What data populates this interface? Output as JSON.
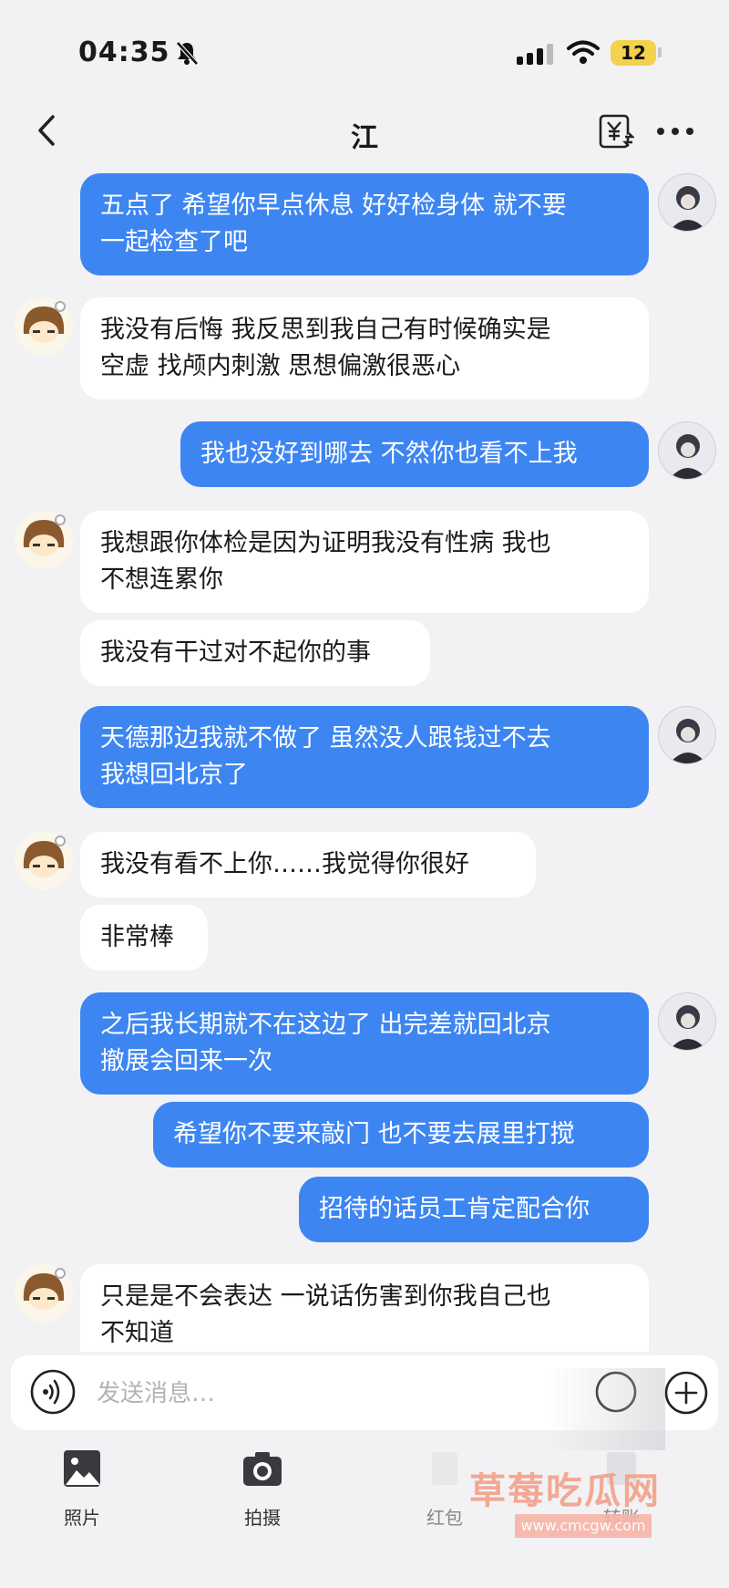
{
  "status_bar": {
    "time": "04:35",
    "battery": "12",
    "icons": [
      "bell-muted-icon",
      "signal-icon",
      "wifi-icon",
      "battery-icon"
    ]
  },
  "header": {
    "title": "江",
    "icons": [
      "back-icon",
      "transfer-yuan-icon",
      "more-icon"
    ]
  },
  "messages": [
    {
      "side": "sent",
      "text": "五点了 希望你早点休息 好好检身体 就不要\n一起检查了吧"
    },
    {
      "side": "recv",
      "text": "我没有后悔 我反思到我自己有时候确实是\n空虚 找颅内刺激 思想偏激很恶心"
    },
    {
      "side": "sent",
      "text": "我也没好到哪去 不然你也看不上我"
    },
    {
      "side": "recv",
      "text": "我想跟你体检是因为证明我没有性病 我也\n不想连累你"
    },
    {
      "side": "recv",
      "text": "我没有干过对不起你的事"
    },
    {
      "side": "sent",
      "text": "天德那边我就不做了 虽然没人跟钱过不去\n我想回北京了"
    },
    {
      "side": "recv",
      "text": "我没有看不上你……我觉得你很好"
    },
    {
      "side": "recv",
      "text": "非常棒"
    },
    {
      "side": "sent",
      "text": "之后我长期就不在这边了 出完差就回北京\n撤展会回来一次"
    },
    {
      "side": "sent",
      "text": "希望你不要来敲门 也不要去展里打搅"
    },
    {
      "side": "sent",
      "text": "招待的话员工肯定配合你"
    },
    {
      "side": "recv",
      "text": "只是是不会表达 一说话伤害到你我自己也\n不知道"
    }
  ],
  "input": {
    "placeholder": "发送消息…",
    "value": ""
  },
  "toolbar": {
    "items": [
      {
        "label": "照片",
        "icon": "photo-icon"
      },
      {
        "label": "拍摄",
        "icon": "camera-icon"
      },
      {
        "label": "红包",
        "icon": "red-packet-icon"
      },
      {
        "label": "转账",
        "icon": "transfer-icon"
      }
    ]
  },
  "watermark": {
    "text": "草莓吃瓜网",
    "url": "www.cmcgw.com"
  }
}
